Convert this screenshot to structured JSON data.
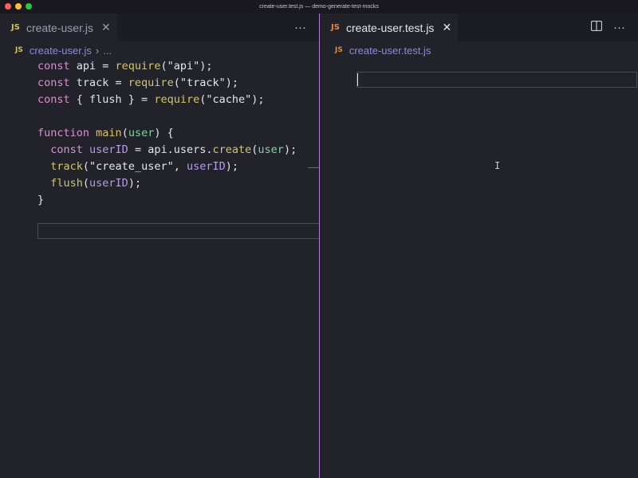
{
  "window": {
    "title": "create-user.test.js — demo-generate-test-mocks"
  },
  "left": {
    "tab": {
      "badge": "JS",
      "label": "create-user.js"
    },
    "actions": {
      "more": "···"
    },
    "breadcrumb": {
      "badge": "JS",
      "file": "create-user.js",
      "sep": "›",
      "more": "..."
    },
    "code": [
      "const api = require(\"api\");",
      "const track = require(\"track\");",
      "const { flush } = require(\"cache\");",
      "",
      "function main(user) {",
      "  const userID = api.users.create(user);",
      "  track(\"create_user\", userID);",
      "  flush(userID);",
      "}"
    ]
  },
  "right": {
    "tab": {
      "badge": "JS",
      "label": "create-user.test.js",
      "close": "✕"
    },
    "actions": {
      "split": "split-editor-icon",
      "more": "···"
    },
    "breadcrumb": {
      "badge": "JS",
      "file": "create-user.test.js"
    }
  },
  "colors": {
    "accent": "#b17ad8",
    "keyword": "#e48ad2",
    "function": "#d4c46a",
    "variable": "#b89ae6",
    "param": "#7ed2a2"
  }
}
